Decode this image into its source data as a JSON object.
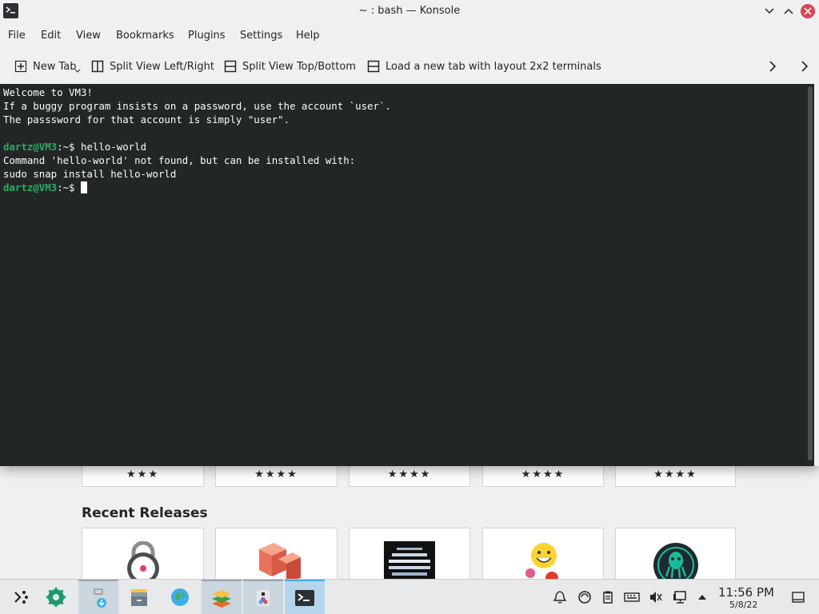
{
  "window": {
    "title": "~ : bash — Konsole"
  },
  "menubar": {
    "items": [
      "File",
      "Edit",
      "View",
      "Bookmarks",
      "Plugins",
      "Settings",
      "Help"
    ]
  },
  "toolbar": {
    "new_tab": "New Tab",
    "split_left_right": "Split View Left/Right",
    "split_top_bottom": "Split View Top/Bottom",
    "load_layout": "Load a new tab with layout 2x2 terminals"
  },
  "terminal": {
    "lines": [
      {
        "text": "Welcome to VM3!"
      },
      {
        "text": "If a buggy program insists on a password, use the account `user`."
      },
      {
        "text": "The passsword for that account is simply \"user\"."
      },
      {
        "text": ""
      },
      {
        "prompt": "dartz@VM3",
        "path": ":~$ ",
        "text": "hello-world"
      },
      {
        "text": "Command 'hello-world' not found, but can be installed with:"
      },
      {
        "text": "sudo snap install hello-world"
      },
      {
        "prompt": "dartz@VM3",
        "path": ":~$ ",
        "text": "",
        "cursor": true
      }
    ]
  },
  "background_app": {
    "ratings": [
      "★★★",
      "★★★★",
      "★★★★",
      "★★★★",
      "★★★★"
    ],
    "section_title": "Recent Releases",
    "cards": [
      "lock-app-icon",
      "package-app-icon",
      "striped-globe-app-icon",
      "emoji-app-icon",
      "kraken-app-icon"
    ]
  },
  "taskbar": {
    "clock_time": "11:56 PM",
    "clock_date": "5/8/22"
  },
  "colors": {
    "terminal_bg": "#232627",
    "prompt": "#27ae60",
    "close_button": "#da4453"
  }
}
